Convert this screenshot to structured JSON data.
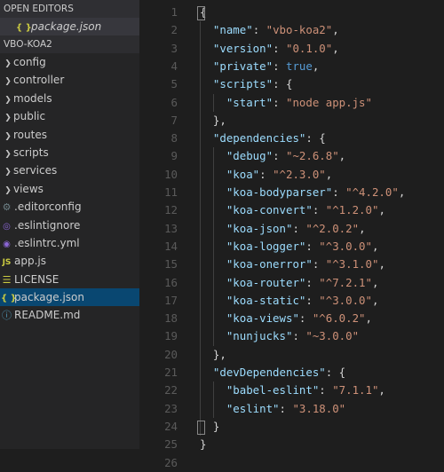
{
  "sidebar": {
    "open_editors_header": "OPEN EDITORS",
    "open_editors": [
      {
        "label": "package.json",
        "icon": "json-icon"
      }
    ],
    "project_header": "VBO-KOA2",
    "folders": [
      {
        "label": "config"
      },
      {
        "label": "controller"
      },
      {
        "label": "models"
      },
      {
        "label": "public"
      },
      {
        "label": "routes"
      },
      {
        "label": "scripts"
      },
      {
        "label": "services"
      },
      {
        "label": "views"
      }
    ],
    "files": [
      {
        "label": ".editorconfig",
        "icon": "gear-icon",
        "glyph": "⚙"
      },
      {
        "label": ".eslintignore",
        "icon": "eslint-icon",
        "glyph": "◎"
      },
      {
        "label": ".eslintrc.yml",
        "icon": "eslint-icon",
        "glyph": "◉"
      },
      {
        "label": "app.js",
        "icon": "js-icon",
        "glyph": "JS"
      },
      {
        "label": "LICENSE",
        "icon": "license-icon",
        "glyph": "☰"
      },
      {
        "label": "package.json",
        "icon": "json-icon",
        "glyph": "{ }",
        "selected": true
      },
      {
        "label": "README.md",
        "icon": "info-icon",
        "glyph": "ⓘ"
      }
    ]
  },
  "editor": {
    "lines": [
      {
        "n": "1",
        "html": "<span class=\"p\">{</span>"
      },
      {
        "n": "2",
        "html": "  <span class=\"k\">\"name\"</span><span class=\"p\">: </span><span class=\"s\">\"vbo-koa2\"</span><span class=\"p\">,</span>"
      },
      {
        "n": "3",
        "html": "  <span class=\"k\">\"version\"</span><span class=\"p\">: </span><span class=\"s\">\"0.1.0\"</span><span class=\"p\">,</span>"
      },
      {
        "n": "4",
        "html": "  <span class=\"k\">\"private\"</span><span class=\"p\">: </span><span class=\"b\">true</span><span class=\"p\">,</span>"
      },
      {
        "n": "5",
        "html": "  <span class=\"k\">\"scripts\"</span><span class=\"p\">: {</span>"
      },
      {
        "n": "6",
        "html": "    <span class=\"k\">\"start\"</span><span class=\"p\">: </span><span class=\"s\">\"node app.js\"</span>"
      },
      {
        "n": "7",
        "html": "  <span class=\"p\">},</span>"
      },
      {
        "n": "8",
        "html": "  <span class=\"k\">\"dependencies\"</span><span class=\"p\">: {</span>"
      },
      {
        "n": "9",
        "html": "    <span class=\"k\">\"debug\"</span><span class=\"p\">: </span><span class=\"s\">\"~2.6.8\"</span><span class=\"p\">,</span>"
      },
      {
        "n": "10",
        "html": "    <span class=\"k\">\"koa\"</span><span class=\"p\">: </span><span class=\"s\">\"^2.3.0\"</span><span class=\"p\">,</span>"
      },
      {
        "n": "11",
        "html": "    <span class=\"k\">\"koa-bodyparser\"</span><span class=\"p\">: </span><span class=\"s\">\"^4.2.0\"</span><span class=\"p\">,</span>"
      },
      {
        "n": "12",
        "html": "    <span class=\"k\">\"koa-convert\"</span><span class=\"p\">: </span><span class=\"s\">\"^1.2.0\"</span><span class=\"p\">,</span>"
      },
      {
        "n": "13",
        "html": "    <span class=\"k\">\"koa-json\"</span><span class=\"p\">: </span><span class=\"s\">\"^2.0.2\"</span><span class=\"p\">,</span>"
      },
      {
        "n": "14",
        "html": "    <span class=\"k\">\"koa-logger\"</span><span class=\"p\">: </span><span class=\"s\">\"^3.0.0\"</span><span class=\"p\">,</span>"
      },
      {
        "n": "15",
        "html": "    <span class=\"k\">\"koa-onerror\"</span><span class=\"p\">: </span><span class=\"s\">\"^3.1.0\"</span><span class=\"p\">,</span>"
      },
      {
        "n": "16",
        "html": "    <span class=\"k\">\"koa-router\"</span><span class=\"p\">: </span><span class=\"s\">\"^7.2.1\"</span><span class=\"p\">,</span>"
      },
      {
        "n": "17",
        "html": "    <span class=\"k\">\"koa-static\"</span><span class=\"p\">: </span><span class=\"s\">\"^3.0.0\"</span><span class=\"p\">,</span>"
      },
      {
        "n": "18",
        "html": "    <span class=\"k\">\"koa-views\"</span><span class=\"p\">: </span><span class=\"s\">\"^6.0.2\"</span><span class=\"p\">,</span>"
      },
      {
        "n": "19",
        "html": "    <span class=\"k\">\"nunjucks\"</span><span class=\"p\">: </span><span class=\"s\">\"~3.0.0\"</span>"
      },
      {
        "n": "20",
        "html": "  <span class=\"p\">},</span>"
      },
      {
        "n": "21",
        "html": "  <span class=\"k\">\"devDependencies\"</span><span class=\"p\">: {</span>"
      },
      {
        "n": "22",
        "html": "    <span class=\"k\">\"babel-eslint\"</span><span class=\"p\">: </span><span class=\"s\">\"7.1.1\"</span><span class=\"p\">,</span>"
      },
      {
        "n": "23",
        "html": "    <span class=\"k\">\"eslint\"</span><span class=\"p\">: </span><span class=\"s\">\"3.18.0\"</span>"
      },
      {
        "n": "24",
        "html": "  <span class=\"p\">}</span>"
      },
      {
        "n": "25",
        "html": "<span class=\"p\">}</span>"
      },
      {
        "n": "26",
        "html": ""
      }
    ]
  },
  "colors": {
    "sidebar_bg": "#252526",
    "editor_bg": "#1e1e1e",
    "selection": "#094771",
    "key": "#9cdcfe",
    "string": "#ce9178",
    "boolean": "#569cd6"
  }
}
